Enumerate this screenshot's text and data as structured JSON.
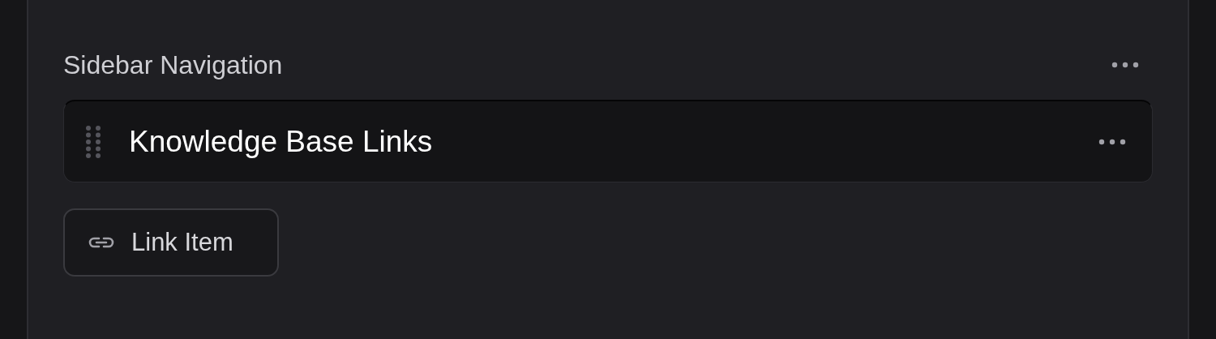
{
  "section": {
    "title": "Sidebar Navigation"
  },
  "items": [
    {
      "label": "Knowledge Base Links"
    }
  ],
  "add_button": {
    "label": "Link Item"
  }
}
